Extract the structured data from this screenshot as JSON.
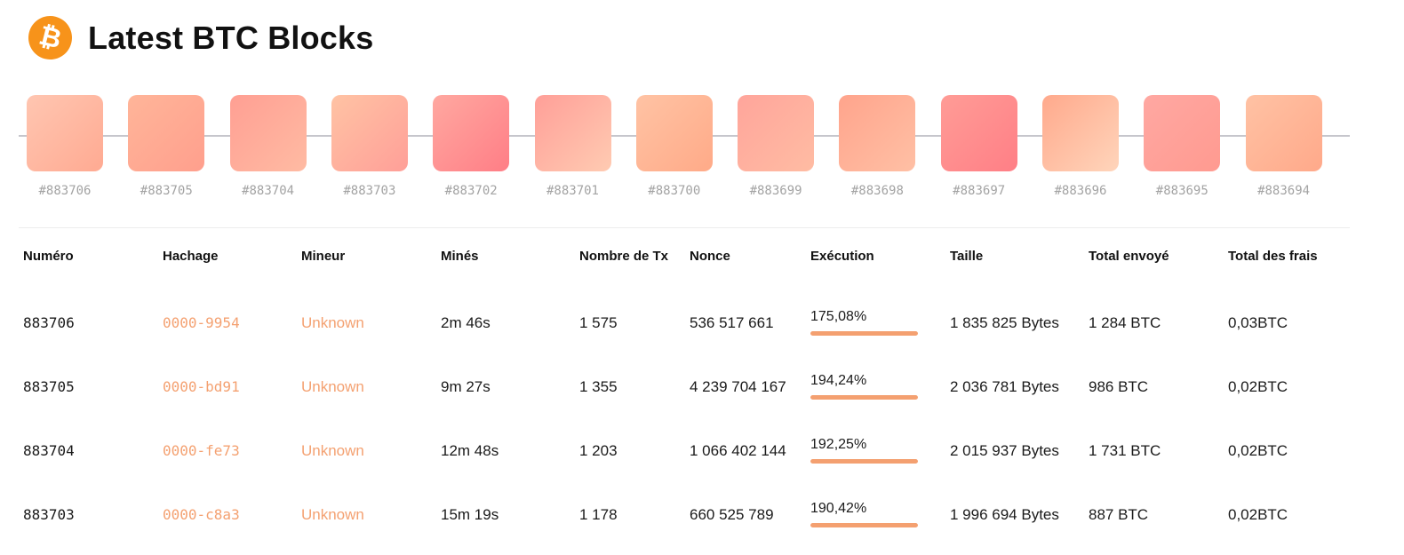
{
  "header": {
    "logo_glyph": "₿",
    "title": "Latest BTC Blocks",
    "logo_color": "#f7931a"
  },
  "blocks": [
    {
      "label": "#883706",
      "gradient": [
        "#ffc6b1",
        "#ffaa92"
      ]
    },
    {
      "label": "#883705",
      "gradient": [
        "#ffb599",
        "#ff9f8d"
      ]
    },
    {
      "label": "#883704",
      "gradient": [
        "#ff9f93",
        "#ffbba3"
      ]
    },
    {
      "label": "#883703",
      "gradient": [
        "#ffc3a4",
        "#ff9f98"
      ]
    },
    {
      "label": "#883702",
      "gradient": [
        "#ffa8a0",
        "#ff7e86"
      ]
    },
    {
      "label": "#883701",
      "gradient": [
        "#ff9f98",
        "#ffcbb2"
      ]
    },
    {
      "label": "#883700",
      "gradient": [
        "#ffc3a4",
        "#ffaa88"
      ]
    },
    {
      "label": "#883699",
      "gradient": [
        "#ffa59b",
        "#ffbca3"
      ]
    },
    {
      "label": "#883698",
      "gradient": [
        "#ffa48c",
        "#ffc0a5"
      ]
    },
    {
      "label": "#883697",
      "gradient": [
        "#ff9c96",
        "#ff7f86"
      ]
    },
    {
      "label": "#883696",
      "gradient": [
        "#ffa98c",
        "#ffd5bb"
      ]
    },
    {
      "label": "#883695",
      "gradient": [
        "#ffa8a2",
        "#ff9a90"
      ]
    },
    {
      "label": "#883694",
      "gradient": [
        "#ffc2a4",
        "#ffa98a"
      ]
    }
  ],
  "table": {
    "headers": [
      "Numéro",
      "Hachage",
      "Mineur",
      "Minés",
      "Nombre de Tx",
      "Nonce",
      "Exécution",
      "Taille",
      "Total envoyé",
      "Total des frais"
    ],
    "accent_color": "#f4a070",
    "rows": [
      {
        "number": "883706",
        "hash": "0000-9954",
        "miner": "Unknown",
        "mined": "2m 46s",
        "tx_count": "1 575",
        "nonce": "536 517 661",
        "execution": "175,08%",
        "size": "1 835 825 Bytes",
        "sent": "1 284 BTC",
        "fees": "0,03BTC"
      },
      {
        "number": "883705",
        "hash": "0000-bd91",
        "miner": "Unknown",
        "mined": "9m 27s",
        "tx_count": "1 355",
        "nonce": "4 239 704 167",
        "execution": "194,24%",
        "size": "2 036 781 Bytes",
        "sent": "986 BTC",
        "fees": "0,02BTC"
      },
      {
        "number": "883704",
        "hash": "0000-fe73",
        "miner": "Unknown",
        "mined": "12m 48s",
        "tx_count": "1 203",
        "nonce": "1 066 402 144",
        "execution": "192,25%",
        "size": "2 015 937 Bytes",
        "sent": "1 731 BTC",
        "fees": "0,02BTC"
      },
      {
        "number": "883703",
        "hash": "0000-c8a3",
        "miner": "Unknown",
        "mined": "15m 19s",
        "tx_count": "1 178",
        "nonce": "660 525 789",
        "execution": "190,42%",
        "size": "1 996 694 Bytes",
        "sent": "887 BTC",
        "fees": "0,02BTC"
      }
    ]
  }
}
